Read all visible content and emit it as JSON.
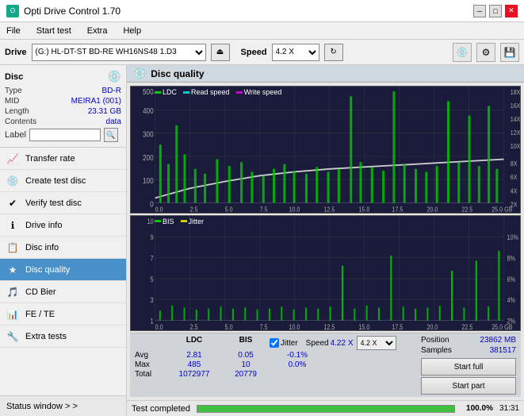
{
  "app": {
    "title": "Opti Drive Control 1.70",
    "icon": "●"
  },
  "titlebar": {
    "minimize_label": "─",
    "maximize_label": "□",
    "close_label": "✕"
  },
  "menubar": {
    "items": [
      {
        "label": "File"
      },
      {
        "label": "Start test"
      },
      {
        "label": "Extra"
      },
      {
        "label": "Help"
      }
    ]
  },
  "drive_toolbar": {
    "drive_label": "Drive",
    "drive_value": "(G:)  HL-DT-ST BD-RE  WH16NS48 1.D3",
    "speed_label": "Speed",
    "speed_value": "4.2 X"
  },
  "disc_panel": {
    "title": "Disc",
    "type_label": "Type",
    "type_value": "BD-R",
    "mid_label": "MID",
    "mid_value": "MEIRA1 (001)",
    "length_label": "Length",
    "length_value": "23.31 GB",
    "contents_label": "Contents",
    "contents_value": "data",
    "label_label": "Label"
  },
  "nav": {
    "items": [
      {
        "id": "transfer-rate",
        "label": "Transfer rate",
        "icon": "📈"
      },
      {
        "id": "create-test-disc",
        "label": "Create test disc",
        "icon": "💿"
      },
      {
        "id": "verify-test-disc",
        "label": "Verify test disc",
        "icon": "✔"
      },
      {
        "id": "drive-info",
        "label": "Drive info",
        "icon": "ℹ"
      },
      {
        "id": "disc-info",
        "label": "Disc info",
        "icon": "📋"
      },
      {
        "id": "disc-quality",
        "label": "Disc quality",
        "icon": "★",
        "active": true
      },
      {
        "id": "cd-bier",
        "label": "CD Bier",
        "icon": "🎵"
      },
      {
        "id": "fe-te",
        "label": "FE / TE",
        "icon": "📊"
      },
      {
        "id": "extra-tests",
        "label": "Extra tests",
        "icon": "🔧"
      }
    ],
    "status_window": "Status window > >"
  },
  "chart": {
    "title": "Disc quality",
    "icon": "💿",
    "top_legend": [
      {
        "label": "LDC",
        "color": "#00aa00"
      },
      {
        "label": "Read speed",
        "color": "#00ffff"
      },
      {
        "label": "Write speed",
        "color": "#ff00ff"
      }
    ],
    "bottom_legend": [
      {
        "label": "BIS",
        "color": "#00aa00"
      },
      {
        "label": "Jitter",
        "color": "#ffff00"
      }
    ],
    "top_y_left": [
      "500",
      "400",
      "300",
      "200",
      "100"
    ],
    "top_y_right": [
      "18X",
      "16X",
      "14X",
      "12X",
      "10X",
      "8X",
      "6X",
      "4X",
      "2X"
    ],
    "bottom_y_left": [
      "10",
      "9",
      "8",
      "7",
      "6",
      "5",
      "4",
      "3",
      "2",
      "1"
    ],
    "bottom_y_right": [
      "10%",
      "8%",
      "6%",
      "4%",
      "2%"
    ],
    "x_labels": [
      "0.0",
      "2.5",
      "5.0",
      "7.5",
      "10.0",
      "12.5",
      "15.0",
      "17.5",
      "20.0",
      "22.5",
      "25.0 GB"
    ]
  },
  "stats": {
    "columns": [
      "LDC",
      "BIS",
      "Jitter"
    ],
    "rows": [
      {
        "label": "Avg",
        "ldc": "2.81",
        "bis": "0.05",
        "jitter": "-0.1%"
      },
      {
        "label": "Max",
        "ldc": "485",
        "bis": "10",
        "jitter": "0.0%"
      },
      {
        "label": "Total",
        "ldc": "1072977",
        "bis": "20779",
        "jitter": ""
      }
    ],
    "jitter_label": "Jitter",
    "speed_label": "Speed",
    "speed_value": "4.22 X",
    "speed_select": "4.2 X",
    "position_label": "Position",
    "position_value": "23862 MB",
    "samples_label": "Samples",
    "samples_value": "381517",
    "start_full_label": "Start full",
    "start_part_label": "Start part"
  },
  "progress": {
    "percent": 100,
    "percent_label": "100.0%",
    "time_label": "31:31"
  },
  "status": {
    "text": "Test completed"
  }
}
